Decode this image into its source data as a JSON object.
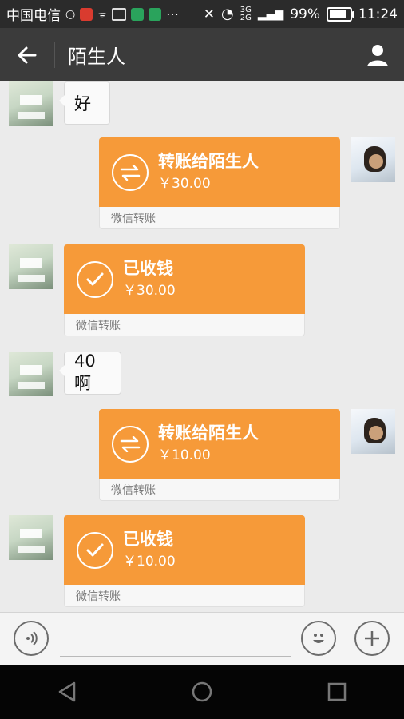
{
  "status": {
    "carrier": "中国电信",
    "network": "3G",
    "network_sub": "2G",
    "battery_level_percent": 99,
    "battery_text": "99%",
    "time": "11:24"
  },
  "toolbar": {
    "title": "陌生人",
    "back_icon": "back-arrow-icon",
    "contact_icon": "person-icon"
  },
  "messages": {
    "m1": {
      "text": "好"
    },
    "m2": {
      "title": "转账给陌生人",
      "amount": "￥30.00",
      "footer": "微信转账"
    },
    "m3": {
      "title": "已收钱",
      "amount": "￥30.00",
      "footer": "微信转账"
    },
    "m4": {
      "text": "40啊"
    },
    "m5": {
      "title": "转账给陌生人",
      "amount": "￥10.00",
      "footer": "微信转账"
    },
    "m6": {
      "title": "已收钱",
      "amount": "￥10.00",
      "footer": "微信转账"
    }
  },
  "input": {
    "voice_icon": "voice-icon",
    "emoji_icon": "emoji-icon",
    "add_icon": "add-icon"
  },
  "nav": {
    "back_icon": "nav-back-icon",
    "home_icon": "nav-home-icon",
    "recent_icon": "nav-recent-icon"
  },
  "colors": {
    "orange": "#f69a39",
    "toolbar": "#3b3b3b",
    "chat_bg": "#ebebeb"
  }
}
